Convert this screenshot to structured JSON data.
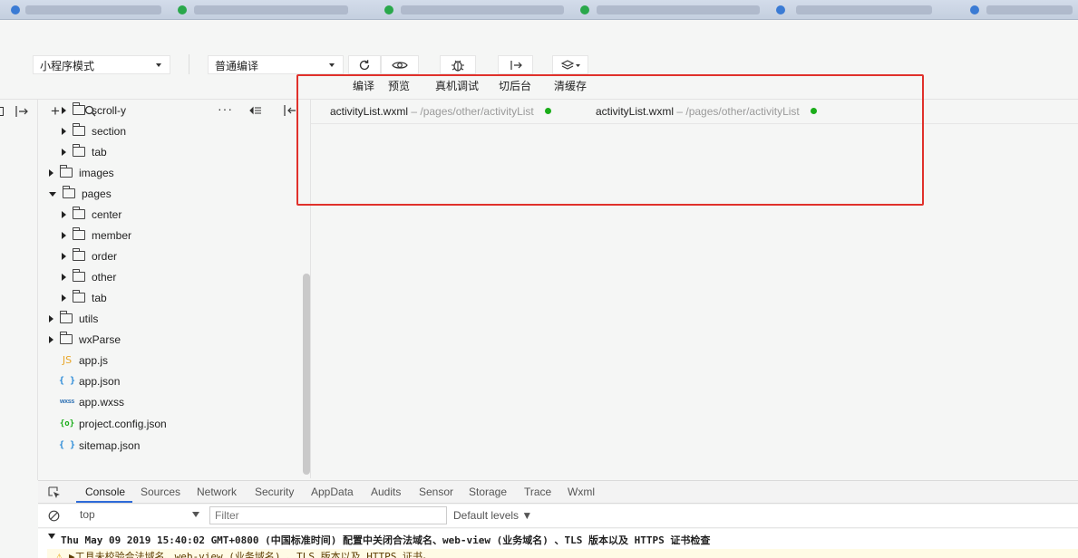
{
  "toolbar": {
    "mode_select": "小程序模式",
    "compile_select": "普通编译",
    "labels": {
      "compile": "编译",
      "preview": "预览",
      "real_debug": "真机调试",
      "backstage": "切后台",
      "clear_cache": "清缓存"
    }
  },
  "explorer": {
    "items": [
      {
        "label": "scroll-y",
        "type": "folder"
      },
      {
        "label": "section",
        "type": "folder"
      },
      {
        "label": "tab",
        "type": "folder"
      },
      {
        "label": "images",
        "type": "folder"
      },
      {
        "label": "pages",
        "type": "folder-open"
      },
      {
        "label": "center",
        "type": "folder"
      },
      {
        "label": "member",
        "type": "folder"
      },
      {
        "label": "order",
        "type": "folder"
      },
      {
        "label": "other",
        "type": "folder"
      },
      {
        "label": "tab",
        "type": "folder"
      },
      {
        "label": "utils",
        "type": "folder"
      },
      {
        "label": "wxParse",
        "type": "folder"
      },
      {
        "label": "app.js",
        "type": "js",
        "icon": "JS"
      },
      {
        "label": "app.json",
        "type": "json",
        "icon": "{ }"
      },
      {
        "label": "app.wxss",
        "type": "wxss",
        "icon": "wxss"
      },
      {
        "label": "project.config.json",
        "type": "cfg",
        "icon": "{o}"
      },
      {
        "label": "sitemap.json",
        "type": "json",
        "icon": "{ }"
      }
    ]
  },
  "editor": {
    "tabs": [
      {
        "file": "activityList.wxml",
        "path": " – /pages/other/activityList"
      },
      {
        "file": "activityList.wxml",
        "path": " – /pages/other/activityList"
      }
    ]
  },
  "devtools": {
    "tabs": [
      "Console",
      "Sources",
      "Network",
      "Security",
      "AppData",
      "Audits",
      "Sensor",
      "Storage",
      "Trace",
      "Wxml"
    ],
    "context": "top",
    "filter_placeholder": "Filter",
    "levels": "Default levels ▼",
    "log_line": "Thu May 09 2019 15:40:02 GMT+0800 (中国标准时间) 配置中关闭合法域名、web-view (业务域名) 、TLS 版本以及 HTTPS 证书检查",
    "warning_line": "▶工具未校验合法域名、web-view (业务域名) 、TLS 版本以及 HTTPS 证书。"
  },
  "colors": {
    "highlight_red": "#e0312b",
    "status_green": "#1aad19",
    "active_tab_blue": "#2d6ad8"
  }
}
